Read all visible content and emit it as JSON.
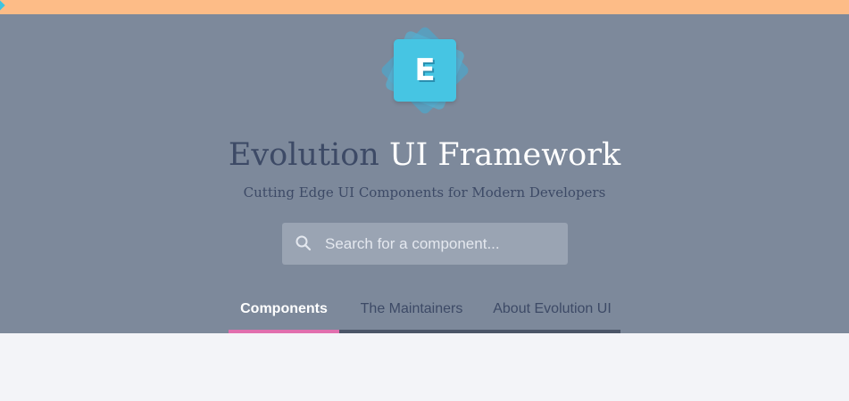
{
  "header": {
    "logo_letter": "E",
    "title_strong": "Evolution",
    "title_light": "UI Framework",
    "subtitle": "Cutting Edge UI Components for Modern Developers"
  },
  "search": {
    "placeholder": "Search for a component...",
    "value": "",
    "icon": "search-icon"
  },
  "tabs": [
    {
      "label": "Components",
      "active": true
    },
    {
      "label": "The Maintainers",
      "active": false
    },
    {
      "label": "About Evolution UI",
      "active": false
    }
  ],
  "colors": {
    "top_bar": "#fdbc87",
    "hero_background": "#7d899b",
    "logo": "#46c5e3",
    "title_dark": "#3d4a66",
    "active_tab_underline": "#e16fae",
    "tab_underline": "#4b5568",
    "page_background": "#f3f4f8"
  }
}
